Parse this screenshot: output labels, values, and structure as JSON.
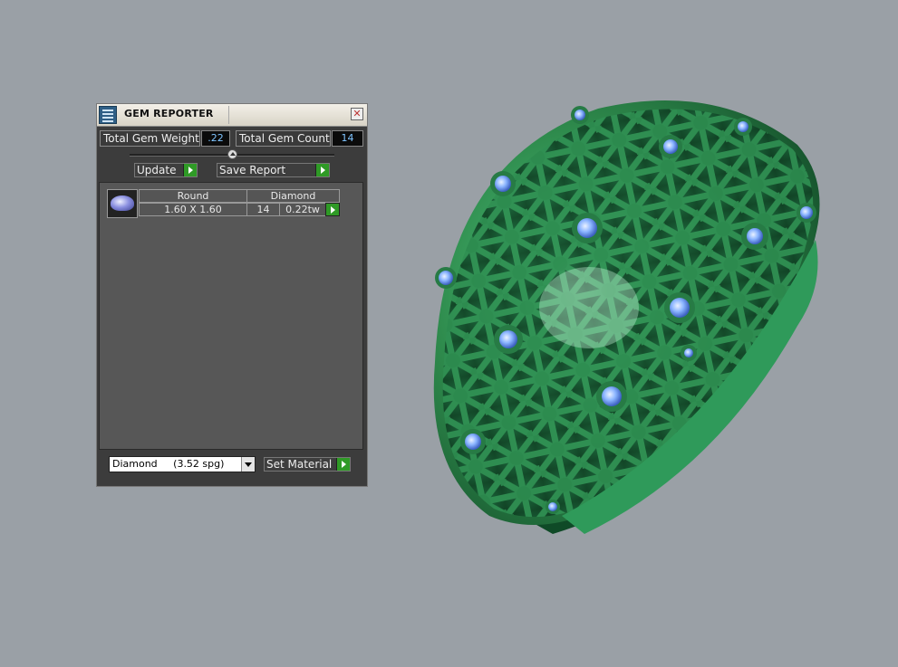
{
  "panel": {
    "title": "GEM REPORTER",
    "close_icon": "close-icon",
    "app_icon": "gem-reporter-icon",
    "total_weight_label": "Total Gem Weight",
    "total_weight_value": ".22",
    "total_count_label": "Total Gem Count",
    "total_count_value": "14",
    "update_label": "Update",
    "save_report_label": "Save Report",
    "gems": [
      {
        "shape": "Round",
        "material": "Diamond",
        "size": "1.60 X 1.60",
        "count": "14",
        "weight": "0.22tw"
      }
    ],
    "material_select_value": "Diamond     (3.52 spg)",
    "set_material_label": "Set Material"
  },
  "colors": {
    "accent_green": "#2f9a26",
    "metal_green": "#2e8a4c",
    "gem_blue": "#8ab4ff",
    "background": "#9aa0a6"
  },
  "viewport": {
    "object": "green pierced dome ring with round blue gemstones"
  }
}
